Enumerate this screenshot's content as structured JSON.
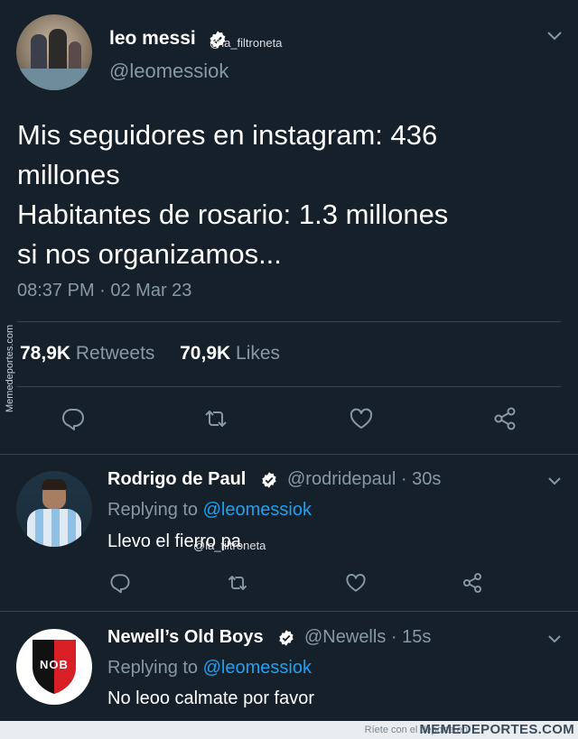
{
  "main_tweet": {
    "author_name": "leo messi",
    "author_handle": "@leomessiok",
    "text_lines": [
      "Mis seguidores en instagram: 436",
      "millones",
      "Habitantes de rosario: 1.3 millones",
      "si nos organizamos..."
    ],
    "timestamp": "08:37 PM · 02 Mar 23",
    "retweets_count": "78,9K",
    "retweets_label": "Retweets",
    "likes_count": "70,9K",
    "likes_label": "Likes"
  },
  "watermarks": {
    "overlay_handle": "@la_filtroneta",
    "side_text": "Memedeportes.com",
    "footer_text": "Ríete con el deporte en",
    "footer_brand": "MEMEDEPORTES.COM"
  },
  "replies": [
    {
      "author_name": "Rodrigo de Paul",
      "author_handle": "@rodridepaul · 30s",
      "replying_label": "Replying to",
      "replying_to": "@leomessiok",
      "text": "Llevo el fierro pa"
    },
    {
      "author_name": "Newell’s Old Boys",
      "author_handle": "@Newells · 15s",
      "replying_label": "Replying to",
      "replying_to": "@leomessiok",
      "text": "No leoo calmate por favor",
      "avatar_text": "NOB"
    }
  ],
  "icons": [
    "verified-badge-icon",
    "chevron-down-icon",
    "reply-icon",
    "retweet-icon",
    "like-icon",
    "share-icon"
  ],
  "colors": {
    "background": "#15202b",
    "secondary_text": "#8899a6",
    "link": "#1da1f2",
    "divider": "#38444d",
    "nob_red": "#d81f26"
  }
}
